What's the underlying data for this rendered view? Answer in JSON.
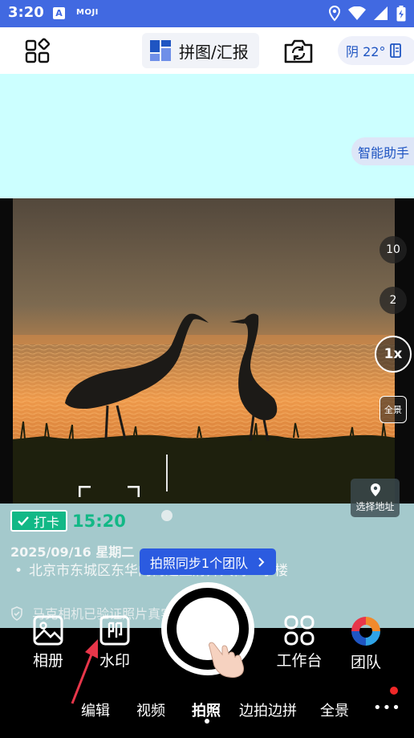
{
  "status_bar": {
    "time": "3:20",
    "app_badge": "A",
    "moji_label": "MOJI"
  },
  "toolbar": {
    "collage_label": "拼图/汇报",
    "weather_label": "阴 22°"
  },
  "assistant_label": "智能助手",
  "zoom": {
    "level_10": "10",
    "level_2": "2",
    "active": "1x",
    "panorama": "全景"
  },
  "location_button": "选择地址",
  "watermark": {
    "checkin_label": "打卡",
    "time": "15:20",
    "date": "2025/09/16  星期二",
    "address": "北京市东城区东华门街道王府井大街一字楼",
    "verify_text": "马克相机已验证照片真实性"
  },
  "sync_pill": "拍照同步1个团队",
  "controls": {
    "album": "相册",
    "watermark": "水印",
    "workbench": "工作台",
    "team": "团队"
  },
  "modes": [
    "编辑",
    "视频",
    "拍照",
    "边拍边拼",
    "全景"
  ],
  "active_mode": "拍照",
  "more_label": "•••",
  "colors": {
    "status_bar": "#4169e1",
    "accent_blue": "#1f55c2",
    "checkin_green": "#12b886",
    "sync_blue": "#2b5be0",
    "preview_cyan": "#ccffff",
    "notification_red": "#f02828"
  }
}
